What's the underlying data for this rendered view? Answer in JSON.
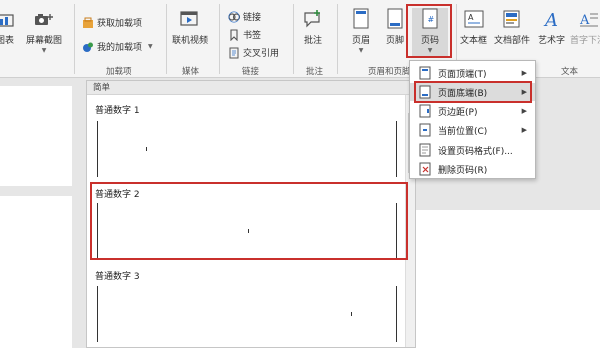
{
  "ribbon": {
    "table_label": "图表",
    "screenshot_label": "屏幕截图",
    "get_addins_label": "获取加载项",
    "my_addins_label": "我的加载项",
    "online_video_label": "联机视频",
    "link_label": "链接",
    "bookmark_label": "书签",
    "crossref_label": "交叉引用",
    "comment_label": "批注",
    "header_label": "页眉",
    "footer_label": "页脚",
    "page_number_label": "页码",
    "textbox_label": "文本框",
    "quickparts_label": "文档部件",
    "wordart_label": "艺术字",
    "dropcap_label": "首字下沉",
    "groups": {
      "addins": "加载项",
      "media": "媒体",
      "links": "链接",
      "comments": "批注",
      "header_footer": "页眉和页脚",
      "text": "文本"
    }
  },
  "gallery": {
    "header": "简单",
    "options": [
      {
        "title": "普通数字 1"
      },
      {
        "title": "普通数字 2"
      },
      {
        "title": "普通数字 3"
      }
    ]
  },
  "menu": {
    "items": [
      {
        "label": "页面顶端(T)",
        "has_submenu": true
      },
      {
        "label": "页面底端(B)",
        "has_submenu": true
      },
      {
        "label": "页边距(P)",
        "has_submenu": true
      },
      {
        "label": "当前位置(C)",
        "has_submenu": true
      },
      {
        "label": "设置页码格式(F)...",
        "has_submenu": false
      },
      {
        "label": "删除页码(R)",
        "has_submenu": false
      }
    ]
  },
  "colors": {
    "highlight": "#c9302c",
    "accent_blue": "#2b6cc4",
    "green": "#2f8a3e"
  }
}
